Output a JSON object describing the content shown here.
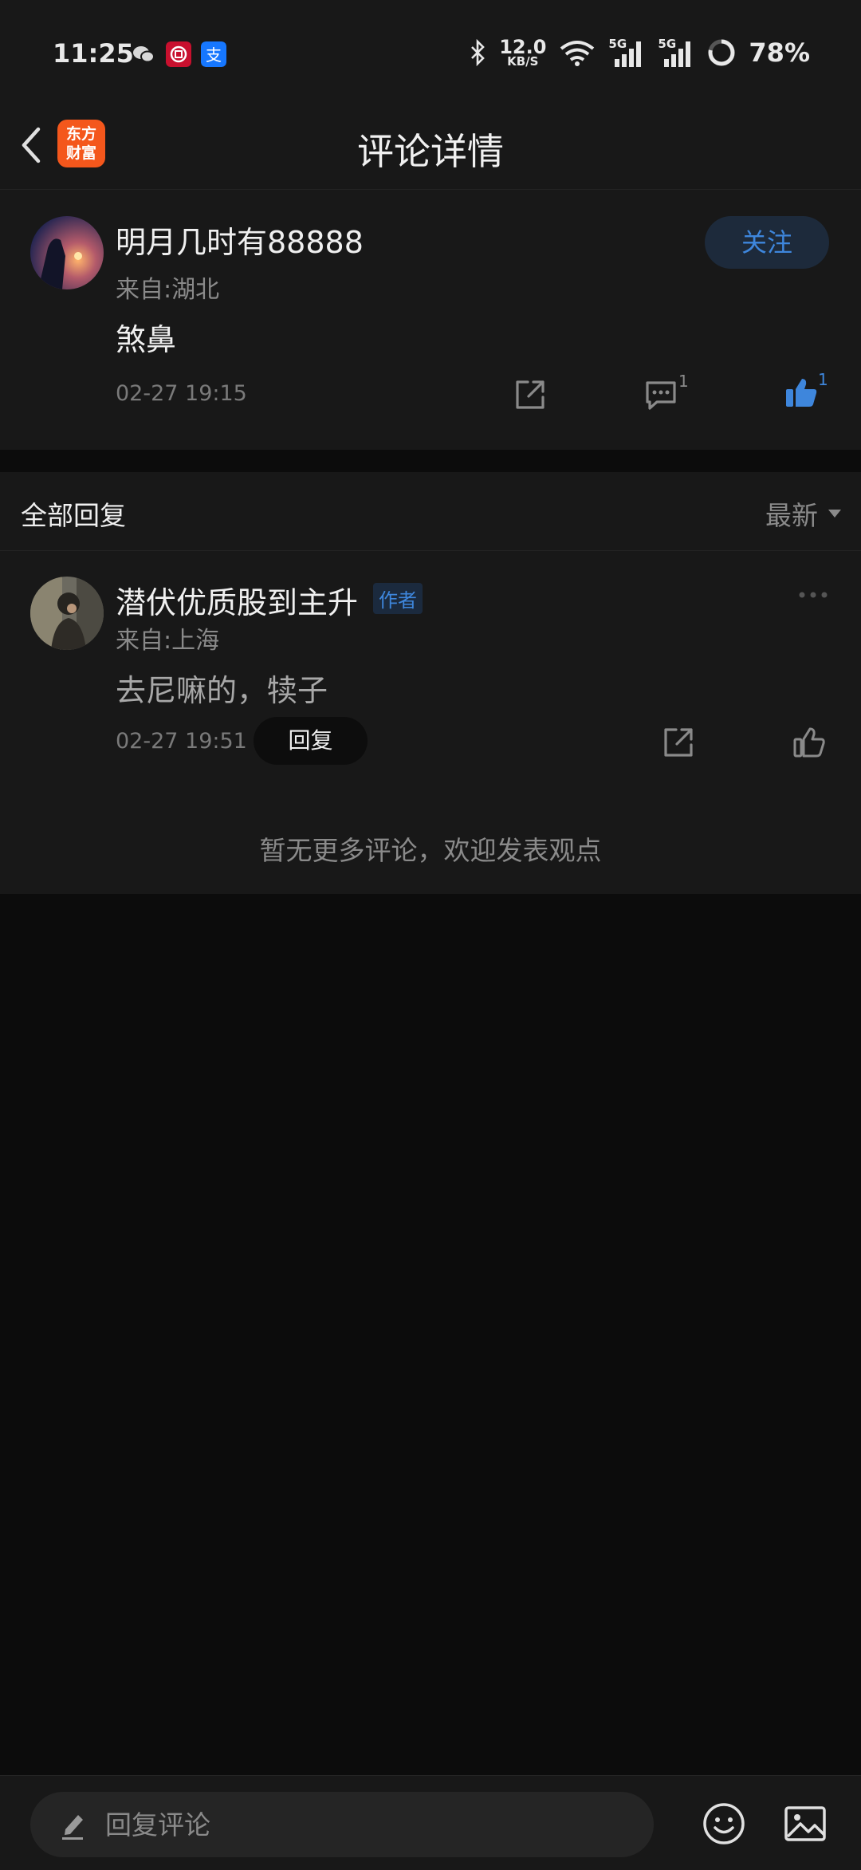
{
  "status_bar": {
    "time": "11:25",
    "net_speed_value": "12.0",
    "net_speed_unit": "KB/S",
    "signal_label_1": "5G",
    "signal_label_2": "5G",
    "battery": "78%"
  },
  "nav": {
    "logo_line1": "东方",
    "logo_line2": "财富",
    "title": "评论详情"
  },
  "main_comment": {
    "author": "明月几时有88888",
    "location": "来自:湖北",
    "follow_label": "关注",
    "text": "煞鼻",
    "time": "02-27 19:15",
    "reply_count": "1",
    "like_count": "1"
  },
  "replies": {
    "title": "全部回复",
    "sort_label": "最新",
    "items": [
      {
        "author": "潜伏优质股到主升",
        "badge": "作者",
        "location": "来自:上海",
        "text": "去尼嘛的，犊子",
        "time": "02-27 19:51",
        "reply_label": "回复"
      }
    ],
    "no_more": "暂无更多评论，欢迎发表观点"
  },
  "bottom_bar": {
    "placeholder": "回复评论"
  },
  "colors": {
    "accent_blue": "#3e86dc",
    "logo_orange": "#f4571c",
    "background": "#0c0c0c",
    "panel": "#181818"
  }
}
